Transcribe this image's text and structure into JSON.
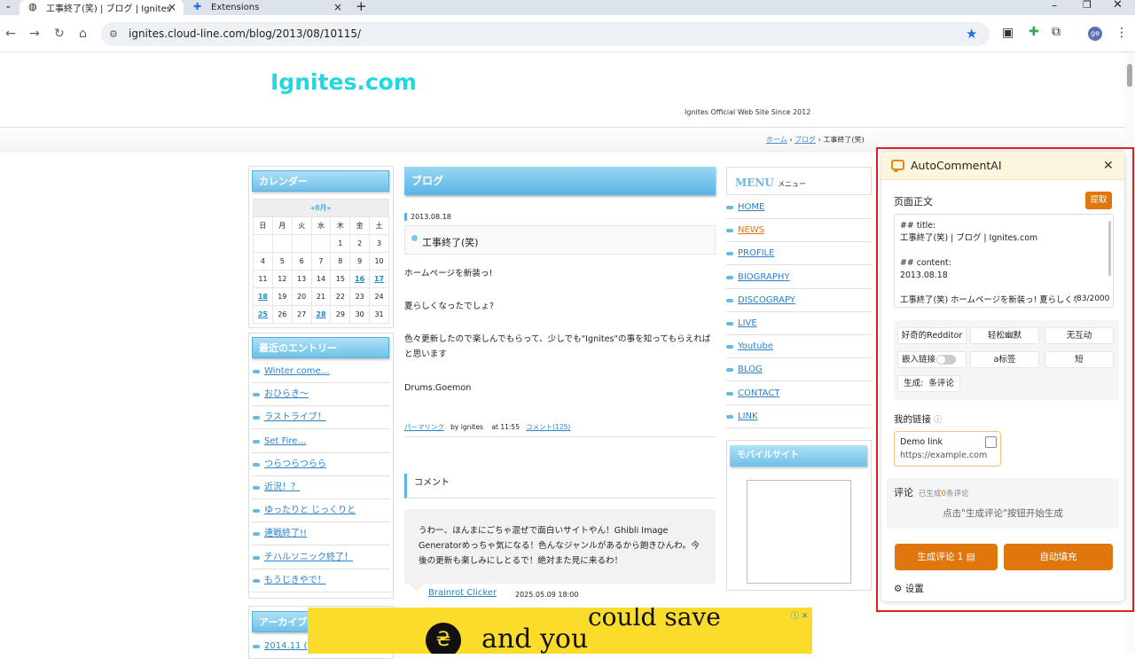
{
  "browser": {
    "tabs": [
      {
        "title": "工事終了(笑) | ブログ | Ignites",
        "icon": "globe-icon"
      },
      {
        "title": "Extensions",
        "icon": "puzzle-icon"
      }
    ],
    "new_tab": "+",
    "url": "ignites.cloud-line.com/blog/2013/08/10115/",
    "profile_initials": "ge"
  },
  "site": {
    "title": "Ignites.com",
    "subtitle": "Ignites Official Web Site Since 2012",
    "breadcrumb": {
      "home": "ホーム",
      "sep1": "›",
      "blog": "ブログ",
      "sep2": "›",
      "current": "工事終了(笑)"
    }
  },
  "sidebar": {
    "calendar_title": "カレンダー",
    "month": "«8月»",
    "weekdays": [
      "日",
      "月",
      "火",
      "水",
      "木",
      "金",
      "土"
    ],
    "weeks": [
      [
        "",
        "",
        "",
        "",
        "1",
        "2",
        "3"
      ],
      [
        "4",
        "5",
        "6",
        "7",
        "8",
        "9",
        "10"
      ],
      [
        "11",
        "12",
        "13",
        "14",
        "15",
        "16",
        "17"
      ],
      [
        "18",
        "19",
        "20",
        "21",
        "22",
        "23",
        "24"
      ],
      [
        "25",
        "26",
        "27",
        "28",
        "29",
        "30",
        "31"
      ]
    ],
    "linked_days": [
      "16",
      "17",
      "18",
      "25",
      "28"
    ],
    "recent_title": "最近のエントリー",
    "recent": [
      "Winter come…",
      "おひらき〜",
      "ラストライブ！",
      "Set Fire…",
      "つらつらつらら",
      "近況！？",
      "ゆったりと じっくりと",
      "連戦終了!!",
      "チハルソニック終了！",
      "もうじきやで！"
    ],
    "archive_title": "アーカイブ",
    "archive_first": "2014.11 ("
  },
  "post": {
    "section_title": "ブログ",
    "date": "2013.08.18",
    "title": "工事終了(笑)",
    "paragraphs": [
      "ホームページを新装っ!",
      "夏らしくなったでしょ?",
      "色々更新したので楽しんでもらって、少しでも\"Ignites\"の事を知ってもらえればと思います",
      "Drums.Goemon"
    ],
    "permalink": "パーマリンク",
    "by": "by ignites",
    "at": "at 11:55",
    "comments_link": "コメント(125)",
    "comment_heading": "コメント",
    "comment_text": "うわー、ほんまにごちゃ混ぜで面白いサイトやん！Ghibli Image Generatorめっちゃ気になる！色んなジャンルがあるから飽きひんわ。今後の更新も楽しみにしとるで！絶対また見に来るわ！",
    "comment_author": "Brainrot Clicker",
    "comment_time": "2025.05.09 18:00"
  },
  "menu": {
    "title": "MENU",
    "title_sub": "メニュー",
    "items": [
      "HOME",
      "NEWS",
      "PROFILE",
      "BIOGRAPHY",
      "DISCOGRAPY",
      "LIVE",
      "Youtube",
      "BLOG",
      "CONTACT",
      "LINK"
    ],
    "active_color": "#e0770e",
    "mobile_title": "モバイルサイト"
  },
  "ad": {
    "line1": "could save",
    "line2": "and you",
    "logo": "₴"
  },
  "extension": {
    "title": "AutoCommentAI",
    "page_text_label": "页面正文",
    "extract_button": "提取",
    "page_text": "## title:\n工事終了(笑) | ブログ | Ignites.com\n\n## content:\n2013.08.18\n\n工事終了(笑) ホームページを新装っ! 夏らしくな",
    "char_count": "83/2000",
    "options": {
      "style1": "好奇的Redditor",
      "style2": "轻松幽默",
      "style3": "无互动",
      "embed_link": "嵌入链接",
      "a_tag": "a标签",
      "length": "短",
      "generate_label": "生成:",
      "generate_count": "条评论"
    },
    "my_links_label": "我的链接",
    "link_card": {
      "name": "Demo link",
      "url": "https://example.com"
    },
    "comment_label": "评论",
    "comment_generated_prefix": "已生成",
    "comment_generated_count": "0",
    "comment_generated_suffix": "条评论",
    "comment_hint": "点击\"生成评论\"按钮开始生成",
    "generate_button": "生成评论 1",
    "autofill_button": "自动填充",
    "settings_label": "设置",
    "accent_color": "#e0770e"
  }
}
